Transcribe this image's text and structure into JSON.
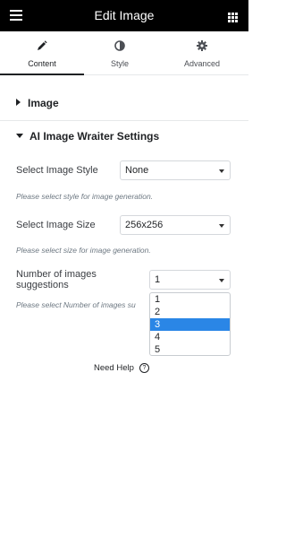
{
  "header": {
    "title": "Edit Image"
  },
  "tabs": [
    {
      "label": "Content",
      "icon": "pencil-icon",
      "active": true
    },
    {
      "label": "Style",
      "icon": "contrast-icon",
      "active": false
    },
    {
      "label": "Advanced",
      "icon": "gear-icon",
      "active": false
    }
  ],
  "sections": {
    "image": {
      "title": "Image"
    },
    "ai": {
      "title": "AI Image Wraiter Settings"
    }
  },
  "fields": {
    "style": {
      "label": "Select Image Style",
      "value": "None",
      "help": "Please select style for image generation."
    },
    "size": {
      "label": "Select Image Size",
      "value": "256x256",
      "help": "Please select size for image generation."
    },
    "count": {
      "label": "Number of images suggestions",
      "value": "1",
      "help": "Please select Number of images su",
      "options": [
        "1",
        "2",
        "3",
        "4",
        "5"
      ],
      "highlighted": "3"
    }
  },
  "footer": {
    "need_help": "Need Help"
  },
  "colors": {
    "header_bg": "#000000",
    "highlight": "#2a86e6"
  }
}
